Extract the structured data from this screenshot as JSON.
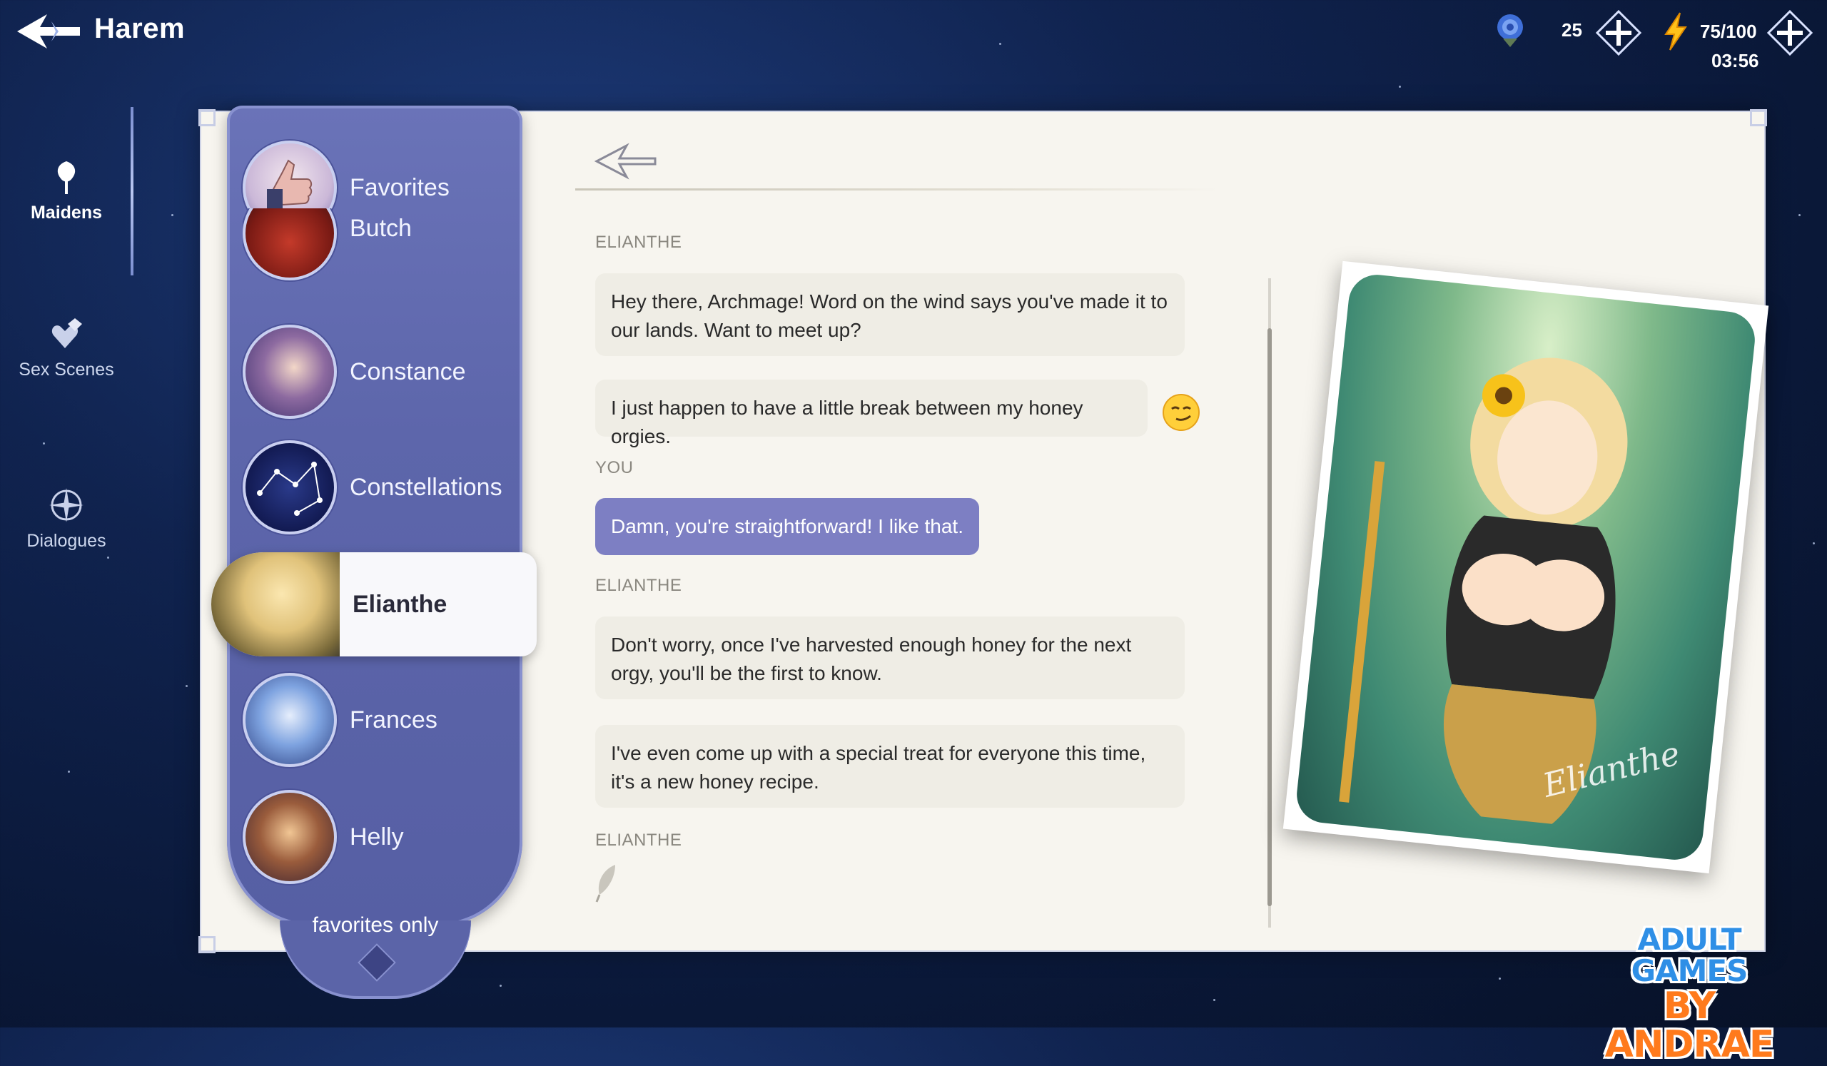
{
  "header": {
    "title": "Harem",
    "roses": "25",
    "energy": "75/100",
    "timer": "03:56"
  },
  "nav": {
    "items": [
      {
        "label": "Maidens",
        "icon": "rose-icon",
        "active": true
      },
      {
        "label": "Sex Scenes",
        "icon": "hearts-icon",
        "active": false
      },
      {
        "label": "Dialogues",
        "icon": "compass-icon",
        "active": false
      }
    ]
  },
  "characters": [
    {
      "name": "Favorites",
      "icon": "thumbs-up-icon"
    },
    {
      "name": "Butch"
    },
    {
      "name": "Constance"
    },
    {
      "name": "Constellations"
    },
    {
      "name": "Elianthe",
      "selected": true
    },
    {
      "name": "Frances"
    },
    {
      "name": "Helly"
    }
  ],
  "filter": {
    "label": "favorites only"
  },
  "chat": {
    "messages": [
      {
        "speaker": "ELIANTHE",
        "text": "Hey there, Archmage! Word on the wind says you've made it to our lands. Want to meet up?"
      },
      {
        "text": "I just happen to have a little break between my honey orgies.",
        "emoji": "smirk-emoji"
      },
      {
        "speaker": "YOU",
        "text": "Damn, you're straightforward! I like that."
      },
      {
        "speaker": "ELIANTHE",
        "text": "Don't worry, once I've harvested enough honey for the next orgy, you'll be the first to know."
      },
      {
        "text": "I've even come up with a special treat for everyone this time, it's a new honey recipe."
      },
      {
        "speaker": "ELIANTHE"
      }
    ]
  },
  "portrait": {
    "signature": "Elianthe"
  },
  "watermark": {
    "line1": "ADULT GAMES",
    "line2": "BY ANDRAE"
  },
  "colors": {
    "accent": "#7d7fc3",
    "list_bg": "#5d66ab",
    "panel_bg": "#f7f5ef",
    "bubble_bg": "#efede5"
  }
}
